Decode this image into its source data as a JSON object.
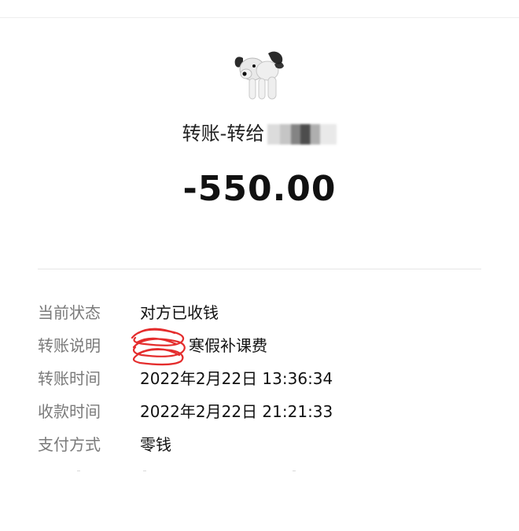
{
  "header": {
    "title_prefix": "转账-转给"
  },
  "amount": "-550.00",
  "details": [
    {
      "label": "当前状态",
      "value": "对方已收钱"
    },
    {
      "label": "转账说明",
      "value": "寒假补课费"
    },
    {
      "label": "转账时间",
      "value": "2022年2月22日 13:36:34"
    },
    {
      "label": "收款时间",
      "value": "2022年2月22日 21:21:33"
    },
    {
      "label": "支付方式",
      "value": "零钱"
    }
  ],
  "colors": {
    "label": "#7a7a7a",
    "value": "#111111",
    "divider": "#e6e6e6",
    "redaction": "#e32222"
  },
  "icons": {
    "avatar": "avatar-dog-image"
  }
}
